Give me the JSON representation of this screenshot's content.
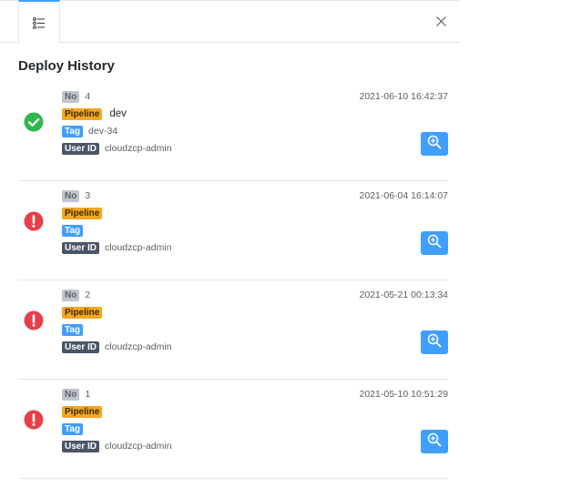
{
  "panel": {
    "title": "Deploy History",
    "tab_icon": "list-icon",
    "close_icon": "close-icon"
  },
  "labels": {
    "no": "No",
    "pipeline": "Pipeline",
    "tag": "Tag",
    "user_id": "User ID"
  },
  "colors": {
    "success": "#2db84d",
    "error": "#e5404a",
    "primary": "#409eff",
    "pipeline_badge": "#f5a623"
  },
  "entries": [
    {
      "status": "success",
      "status_icon": "check-circle-icon",
      "no": "4",
      "time": "2021-06-10 16:42:37",
      "pipeline": "dev",
      "tag": "dev-34",
      "user_id": "cloudzcp-admin"
    },
    {
      "status": "error",
      "status_icon": "exclamation-circle-icon",
      "no": "3",
      "time": "2021-06-04 16:14:07",
      "pipeline": "",
      "tag": "",
      "user_id": "cloudzcp-admin"
    },
    {
      "status": "error",
      "status_icon": "exclamation-circle-icon",
      "no": "2",
      "time": "2021-05-21 00:13:34",
      "pipeline": "",
      "tag": "",
      "user_id": "cloudzcp-admin"
    },
    {
      "status": "error",
      "status_icon": "exclamation-circle-icon",
      "no": "1",
      "time": "2021-05-10 10:51:29",
      "pipeline": "",
      "tag": "",
      "user_id": "cloudzcp-admin"
    }
  ]
}
